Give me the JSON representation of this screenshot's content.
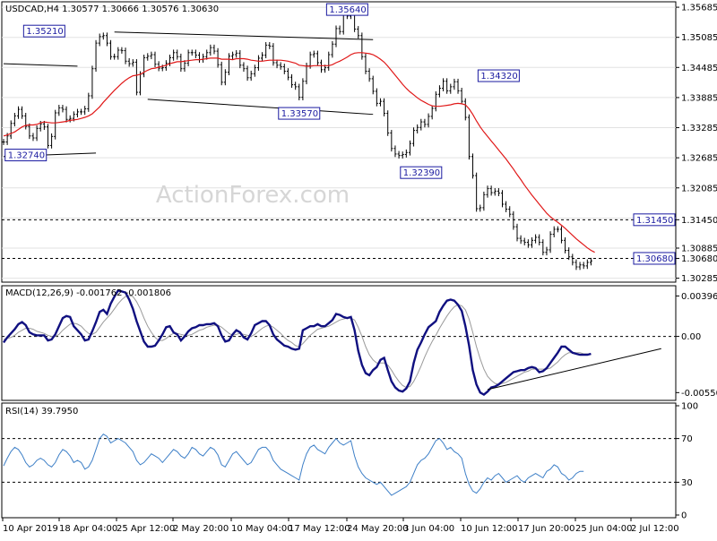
{
  "chart_data": {
    "type": "line",
    "ohlc_header": "USDCAD,H4 1.30577 1.30666 1.30576 1.30630",
    "watermark": "ActionForex.com",
    "price": {
      "ylim": [
        1.3026,
        1.3574
      ],
      "y_ticks": [
        "1.35685",
        "1.35085",
        "1.34485",
        "1.33885",
        "1.33285",
        "1.32685",
        "1.32085",
        "1.31450",
        "1.30885",
        "1.30680",
        "1.30285"
      ],
      "x": [
        0,
        2,
        4,
        6,
        8,
        10,
        12,
        14,
        16,
        18,
        20,
        22,
        24,
        26,
        28,
        30,
        32,
        34,
        36,
        38,
        40,
        42,
        44,
        46,
        48,
        50,
        52,
        54,
        56,
        58,
        60,
        62,
        64,
        66,
        68,
        70,
        72,
        74,
        76,
        78,
        80,
        82,
        84,
        86,
        88,
        90,
        92,
        94,
        96,
        98,
        100,
        102,
        104,
        106,
        108,
        110,
        112,
        114,
        116,
        118,
        120,
        122,
        124,
        126,
        128,
        130,
        132,
        134,
        136,
        138,
        140,
        142,
        144,
        146,
        148,
        150,
        152,
        154,
        156,
        158,
        160,
        162,
        164,
        166,
        168,
        170,
        172,
        174,
        176,
        178,
        180,
        182,
        184,
        186,
        188,
        190,
        192,
        194,
        196,
        198,
        200,
        202,
        204,
        206,
        208,
        210,
        212,
        214,
        216,
        218,
        220,
        222,
        224,
        226,
        228,
        230,
        232,
        234,
        236,
        238,
        240,
        242,
        244,
        246,
        248,
        250,
        252,
        254,
        256,
        258,
        260,
        262,
        264,
        266,
        268,
        270,
        272,
        274,
        276,
        278,
        280,
        282,
        284,
        286,
        288,
        290,
        292,
        294,
        296,
        298,
        300,
        302,
        304,
        306,
        308,
        310,
        312,
        314,
        316,
        318,
        320,
        322,
        324,
        326,
        328,
        330,
        332,
        334,
        336,
        338,
        340,
        342,
        344,
        346,
        348,
        350,
        352,
        354,
        356,
        358
      ],
      "close": [
        1.33,
        1.3312,
        1.3337,
        1.3352,
        1.3365,
        1.3352,
        1.3331,
        1.3312,
        1.3308,
        1.3327,
        1.3336,
        1.333,
        1.3293,
        1.3311,
        1.3358,
        1.3368,
        1.3365,
        1.3345,
        1.3347,
        1.3355,
        1.336,
        1.336,
        1.3366,
        1.3392,
        1.3446,
        1.3497,
        1.351,
        1.3512,
        1.3497,
        1.347,
        1.347,
        1.3483,
        1.3482,
        1.3461,
        1.3456,
        1.3459,
        1.3399,
        1.3435,
        1.3468,
        1.3471,
        1.3474,
        1.3455,
        1.3447,
        1.3448,
        1.3457,
        1.3468,
        1.3478,
        1.347,
        1.3446,
        1.3457,
        1.3478,
        1.3478,
        1.3473,
        1.3464,
        1.347,
        1.3478,
        1.3488,
        1.3481,
        1.3454,
        1.3419,
        1.3439,
        1.3471,
        1.3474,
        1.3477,
        1.3453,
        1.3446,
        1.3428,
        1.3436,
        1.3448,
        1.3467,
        1.3473,
        1.3493,
        1.3491,
        1.3458,
        1.3453,
        1.345,
        1.3441,
        1.3429,
        1.3414,
        1.341,
        1.3389,
        1.3421,
        1.3452,
        1.3474,
        1.3476,
        1.3458,
        1.3444,
        1.3448,
        1.3474,
        1.3495,
        1.3526,
        1.352,
        1.3555,
        1.3551,
        1.3563,
        1.3525,
        1.3512,
        1.347,
        1.3441,
        1.3426,
        1.3401,
        1.3377,
        1.3381,
        1.3357,
        1.3318,
        1.3287,
        1.3276,
        1.3273,
        1.3275,
        1.3279,
        1.3297,
        1.3323,
        1.3329,
        1.334,
        1.3335,
        1.3351,
        1.3367,
        1.3395,
        1.3407,
        1.3421,
        1.3402,
        1.341,
        1.342,
        1.3402,
        1.3381,
        1.3349,
        1.3271,
        1.3233,
        1.3167,
        1.3169,
        1.3195,
        1.3207,
        1.3199,
        1.3202,
        1.3198,
        1.3176,
        1.3166,
        1.3156,
        1.3131,
        1.3108,
        1.3103,
        1.31,
        1.3095,
        1.3104,
        1.311,
        1.31,
        1.308,
        1.3085,
        1.3116,
        1.3126,
        1.3126,
        1.3104,
        1.3084,
        1.3071,
        1.306,
        1.3051,
        1.3055,
        1.3053,
        1.306,
        1.3063
      ],
      "ma": [
        1.3312,
        1.3314,
        1.3317,
        1.332,
        1.3325,
        1.333,
        1.3333,
        1.3334,
        1.3334,
        1.3335,
        1.3338,
        1.334,
        1.3339,
        1.3338,
        1.3338,
        1.3339,
        1.334,
        1.3341,
        1.3343,
        1.3344,
        1.3345,
        1.3347,
        1.3349,
        1.3352,
        1.3356,
        1.3363,
        1.337,
        1.3379,
        1.3387,
        1.3395,
        1.3403,
        1.341,
        1.3417,
        1.3423,
        1.3428,
        1.3432,
        1.3433,
        1.3435,
        1.3439,
        1.3443,
        1.3446,
        1.3447,
        1.3449,
        1.3451,
        1.3453,
        1.3456,
        1.3458,
        1.346,
        1.346,
        1.3461,
        1.3462,
        1.3463,
        1.3464,
        1.3464,
        1.3465,
        1.3466,
        1.3467,
        1.3467,
        1.3467,
        1.3465,
        1.3465,
        1.3465,
        1.3464,
        1.3466,
        1.3466,
        1.3466,
        1.3465,
        1.3463,
        1.3462,
        1.3461,
        1.3461,
        1.3462,
        1.3463,
        1.3463,
        1.3463,
        1.3463,
        1.3462,
        1.3461,
        1.3459,
        1.3457,
        1.3453,
        1.3452,
        1.3451,
        1.3451,
        1.3452,
        1.3452,
        1.3452,
        1.3452,
        1.3452,
        1.3454,
        1.3458,
        1.3461,
        1.3465,
        1.3469,
        1.3474,
        1.3477,
        1.3478,
        1.3478,
        1.3477,
        1.3476,
        1.3474,
        1.347,
        1.3465,
        1.3459,
        1.3451,
        1.3442,
        1.3433,
        1.3424,
        1.3415,
        1.3407,
        1.34,
        1.3394,
        1.3388,
        1.3383,
        1.3379,
        1.3375,
        1.3372,
        1.3371,
        1.3371,
        1.3372,
        1.3373,
        1.3374,
        1.3376,
        1.3377,
        1.3376,
        1.3374,
        1.3366,
        1.3355,
        1.3342,
        1.333,
        1.332,
        1.3311,
        1.3302,
        1.3293,
        1.3284,
        1.3275,
        1.3266,
        1.3256,
        1.3246,
        1.3235,
        1.3225,
        1.3214,
        1.3204,
        1.3194,
        1.3185,
        1.3176,
        1.3167,
        1.3158,
        1.3151,
        1.3145,
        1.314,
        1.3134,
        1.3128,
        1.3121,
        1.3114,
        1.3107,
        1.3101,
        1.3095,
        1.3089,
        1.3084,
        1.308
      ],
      "horizontal_levels": [
        1.3145,
        1.3068
      ],
      "labels": [
        {
          "text": "1.35210",
          "price": 1.3521,
          "at": 22
        },
        {
          "text": "1.32740",
          "price": 1.3274,
          "at": 12
        },
        {
          "text": "1.33570",
          "price": 1.3357,
          "at": 160
        },
        {
          "text": "1.35640",
          "price": 1.3564,
          "at": 186
        },
        {
          "text": "1.32390",
          "price": 1.3239,
          "at": 226
        },
        {
          "text": "1.34320",
          "price": 1.3432,
          "at": 268
        },
        {
          "text": "1.31450",
          "price": 1.3145,
          "at": 359
        },
        {
          "text": "1.30680",
          "price": 1.3068,
          "at": 359
        }
      ],
      "trendlines": [
        {
          "x1": 0,
          "y1": 1.3456,
          "x2": 40,
          "y2": 1.3451
        },
        {
          "x1": 0,
          "y1": 1.3271,
          "x2": 50,
          "y2": 1.3278
        },
        {
          "x1": 60,
          "y1": 1.3519,
          "x2": 200,
          "y2": 1.3504
        },
        {
          "x1": 78,
          "y1": 1.3385,
          "x2": 200,
          "y2": 1.3355
        }
      ]
    },
    "macd": {
      "title": "MACD(12,26,9) -0.001762 -0.001806",
      "ylim": [
        -0.006,
        0.0047
      ],
      "y_ticks": [
        "0.003961",
        "0.00",
        "-0.005503"
      ],
      "zero_label": "0.00",
      "main": [
        -0.0006,
        -0.0001,
        0.0003,
        0.0007,
        0.0012,
        0.0014,
        0.0011,
        0.0004,
        0.0002,
        0.0001,
        0.0001,
        0.0001,
        -0.0004,
        -0.0003,
        0.0002,
        0.001,
        0.0018,
        0.002,
        0.0019,
        0.001,
        0.0006,
        0.0002,
        -0.0004,
        -0.0003,
        0.0005,
        0.0014,
        0.0024,
        0.0026,
        0.0022,
        0.0032,
        0.0039,
        0.0045,
        0.0044,
        0.0043,
        0.0036,
        0.0027,
        0.0015,
        0.0005,
        -0.0005,
        -0.001,
        -0.001,
        -0.0009,
        -0.0004,
        0.0002,
        0.0009,
        0.001,
        0.0004,
        0.0002,
        -0.0004,
        0.0,
        0.0005,
        0.0008,
        0.0009,
        0.0011,
        0.0011,
        0.0012,
        0.0012,
        0.0013,
        0.001,
        0.0001,
        -0.0005,
        -0.0004,
        0.0002,
        0.0006,
        0.0004,
        -0.0001,
        -0.0003,
        0.0003,
        0.0011,
        0.0013,
        0.0015,
        0.0015,
        0.0011,
        0.0002,
        -0.0003,
        -0.0006,
        -0.0009,
        -0.001,
        -0.0012,
        -0.0013,
        -0.0012,
        0.0006,
        0.0008,
        0.001,
        0.001,
        0.0012,
        0.001,
        0.001,
        0.0013,
        0.0016,
        0.0022,
        0.0021,
        0.0019,
        0.0018,
        0.0019,
        0.0006,
        -0.0014,
        -0.0028,
        -0.0036,
        -0.0038,
        -0.0033,
        -0.003,
        -0.0023,
        -0.0021,
        -0.0033,
        -0.0044,
        -0.005,
        -0.0053,
        -0.0054,
        -0.0051,
        -0.0044,
        -0.0026,
        -0.0013,
        -0.0006,
        0.0002,
        0.0009,
        0.0012,
        0.0015,
        0.0024,
        0.003,
        0.0035,
        0.0036,
        0.0035,
        0.0031,
        0.0025,
        0.001,
        -0.0009,
        -0.0033,
        -0.0047,
        -0.0055,
        -0.0057,
        -0.0054,
        -0.005,
        -0.0049,
        -0.0047,
        -0.0044,
        -0.0041,
        -0.0038,
        -0.0035,
        -0.0034,
        -0.0033,
        -0.0033,
        -0.0031,
        -0.003,
        -0.0031,
        -0.0035,
        -0.0034,
        -0.0031,
        -0.0026,
        -0.0021,
        -0.0016,
        -0.001,
        -0.001,
        -0.0013,
        -0.0016,
        -0.0017,
        -0.0018,
        -0.0018,
        -0.0018,
        -0.0017
      ],
      "signal": [
        -0.0003,
        -0.0002,
        -0.0001,
        0.0001,
        0.0004,
        0.0006,
        0.0008,
        0.0008,
        0.0007,
        0.0005,
        0.0004,
        0.0003,
        0.0001,
        0.0,
        0.0,
        0.0002,
        0.0006,
        0.0009,
        0.0012,
        0.0013,
        0.0012,
        0.001,
        0.0006,
        0.0003,
        0.0002,
        0.0004,
        0.0009,
        0.0014,
        0.0018,
        0.0022,
        0.0027,
        0.0032,
        0.0036,
        0.0039,
        0.004,
        0.0039,
        0.0034,
        0.0027,
        0.0018,
        0.001,
        0.0004,
        -0.0001,
        -0.0004,
        -0.0004,
        -0.0002,
        0.0001,
        0.0003,
        0.0003,
        0.0002,
        0.0001,
        0.0001,
        0.0002,
        0.0004,
        0.0006,
        0.0007,
        0.0009,
        0.001,
        0.0011,
        0.0011,
        0.0009,
        0.0006,
        0.0003,
        0.0001,
        0.0002,
        0.0003,
        0.0002,
        0.0001,
        0.0,
        0.0002,
        0.0005,
        0.0008,
        0.001,
        0.0011,
        0.0009,
        0.0006,
        0.0003,
        -0.0001,
        -0.0004,
        -0.0006,
        -0.0009,
        -0.001,
        -0.0007,
        -0.0003,
        0.0001,
        0.0004,
        0.0007,
        0.0008,
        0.0009,
        0.001,
        0.0012,
        0.0014,
        0.0016,
        0.0017,
        0.0018,
        0.0018,
        0.0016,
        0.0009,
        0.0,
        -0.001,
        -0.0018,
        -0.0023,
        -0.0026,
        -0.0026,
        -0.0026,
        -0.0028,
        -0.0033,
        -0.0039,
        -0.0044,
        -0.0048,
        -0.005,
        -0.0049,
        -0.0044,
        -0.0037,
        -0.0029,
        -0.002,
        -0.0012,
        -0.0005,
        0.0001,
        0.0008,
        0.0014,
        0.002,
        0.0025,
        0.0029,
        0.0031,
        0.003,
        0.0026,
        0.0017,
        0.0004,
        -0.001,
        -0.0022,
        -0.0032,
        -0.0039,
        -0.0043,
        -0.0046,
        -0.0047,
        -0.0046,
        -0.0045,
        -0.0043,
        -0.0041,
        -0.0039,
        -0.0037,
        -0.0035,
        -0.0034,
        -0.0032,
        -0.0032,
        -0.0032,
        -0.0032,
        -0.0032,
        -0.0031,
        -0.0028,
        -0.0025,
        -0.0021,
        -0.0018,
        -0.0016,
        -0.0016,
        -0.0016,
        -0.0016,
        -0.0017,
        -0.0017,
        -0.0018
      ],
      "trendline": {
        "x1": 262,
        "y1": -0.0052,
        "x2": 356,
        "y2": -0.0012
      }
    },
    "rsi": {
      "title": "RSI(14) 39.7950",
      "ylim": [
        0,
        100
      ],
      "y_ticks": [
        "100",
        "70",
        "30",
        "0"
      ],
      "levels": [
        70,
        30
      ],
      "values": [
        45,
        52,
        58,
        62,
        60,
        55,
        48,
        44,
        46,
        50,
        52,
        50,
        46,
        44,
        48,
        55,
        60,
        58,
        54,
        48,
        50,
        48,
        42,
        44,
        50,
        60,
        70,
        74,
        72,
        66,
        68,
        70,
        68,
        66,
        62,
        58,
        50,
        46,
        48,
        52,
        56,
        54,
        52,
        48,
        52,
        56,
        60,
        58,
        54,
        52,
        56,
        62,
        60,
        56,
        54,
        58,
        62,
        60,
        55,
        46,
        44,
        50,
        56,
        58,
        54,
        50,
        46,
        48,
        54,
        60,
        62,
        62,
        58,
        50,
        46,
        42,
        40,
        38,
        36,
        34,
        32,
        46,
        56,
        62,
        64,
        60,
        58,
        56,
        62,
        66,
        70,
        66,
        64,
        66,
        68,
        54,
        44,
        38,
        34,
        32,
        30,
        28,
        30,
        26,
        22,
        18,
        20,
        22,
        24,
        26,
        30,
        38,
        46,
        50,
        52,
        56,
        62,
        68,
        70,
        66,
        60,
        62,
        58,
        56,
        52,
        38,
        28,
        22,
        20,
        24,
        30,
        34,
        32,
        36,
        38,
        34,
        30,
        32,
        34,
        36,
        32,
        30,
        34,
        36,
        38,
        36,
        34,
        40,
        42,
        46,
        44,
        38,
        36,
        32,
        34,
        38,
        40,
        40
      ],
      "line_color": "#3d7fc7"
    },
    "x_labels": [
      "10 Apr 2019",
      "18 Apr 04:00",
      "25 Apr 12:00",
      "2 May 20:00",
      "10 May 04:00",
      "17 May 12:00",
      "24 May 20:00",
      "3 Jun 04:00",
      "10 Jun 12:00",
      "17 Jun 20:00",
      "25 Jun 04:00",
      "2 Jul 12:00"
    ],
    "colors": {
      "price": "#000000",
      "ma": "#e01818",
      "macd_main": "#101080",
      "macd_signal": "#9a9a9a",
      "rsi": "#3d7fc7",
      "label": "#1a1aa0"
    }
  }
}
